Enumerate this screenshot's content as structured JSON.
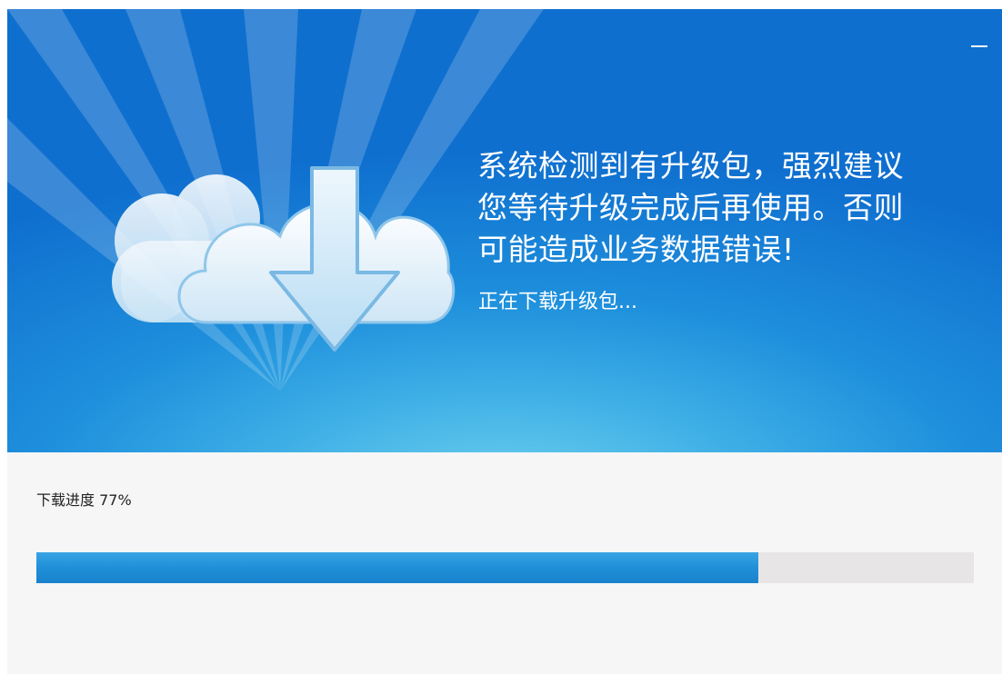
{
  "window": {
    "minimize_label": "—"
  },
  "banner": {
    "message_lines": [
      "系统检测到有升级包，强烈建议",
      "您等待升级完成后再使用。否则",
      "可能造成业务数据错误!"
    ],
    "status_text": "正在下载升级包..."
  },
  "progress": {
    "label": "下载进度 77%",
    "fraction": 0.77
  },
  "colors": {
    "banner_blue": "#1e8fdc",
    "progress_fill": "#1f8fd8",
    "progress_track": "#e7e5e5"
  },
  "icons": {
    "cloud_download": "cloud-download-icon",
    "minimize": "minimize-icon"
  }
}
